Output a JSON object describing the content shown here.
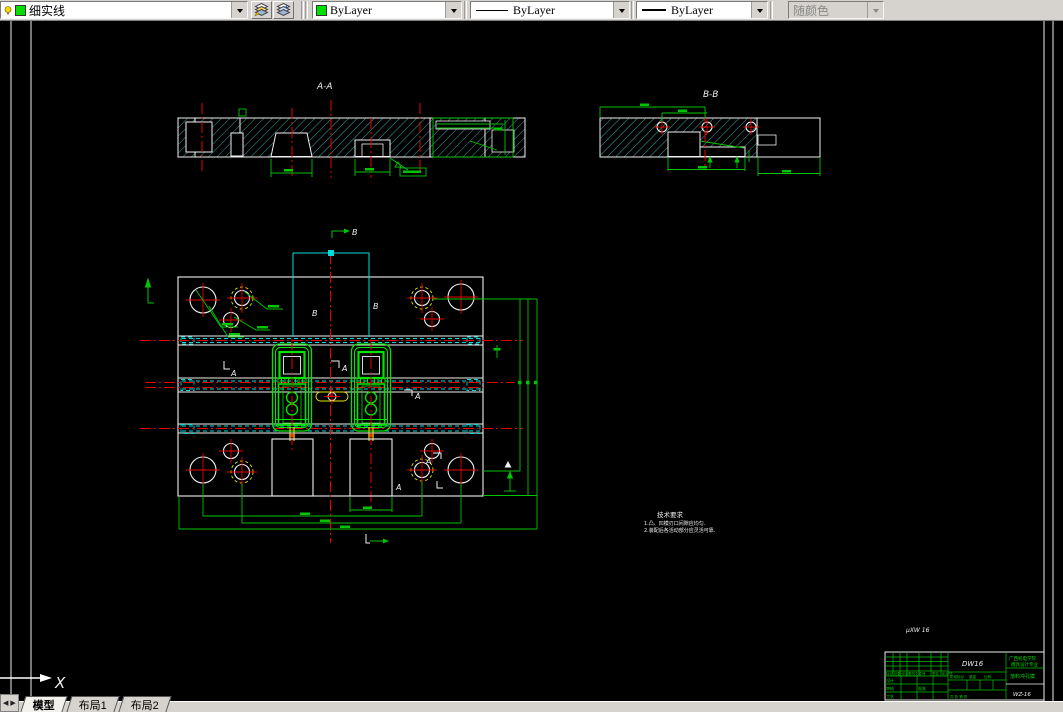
{
  "toolbar": {
    "layer": {
      "name": "细实线",
      "swatch_color": "#00df00"
    },
    "color": {
      "value": "ByLayer",
      "swatch_color": "#00df00"
    },
    "linetype": {
      "value": "ByLayer"
    },
    "lineweight": {
      "value": "ByLayer"
    },
    "plot_style": {
      "value": "随颜色",
      "disabled": true
    }
  },
  "drawing": {
    "section_aa_label": "A-A",
    "section_bb_label": "B-B",
    "marker_a": "A",
    "marker_b": "B",
    "ucs_x_label": "X",
    "notes": {
      "title": "技术要求",
      "line1": "1.凸、凹模刃口间隙应均匀.",
      "line2": "2.装配后各活动部分应灵活可靠."
    },
    "title_block": {
      "above_text": "μXW 16",
      "drawing_code": "DW16",
      "drawing_no": "WZ-16",
      "org_line1": "广西机电学院",
      "org_line2": "模具设计专业",
      "part_name": "落料冲孔模",
      "header_cells": [
        "标记",
        "处数",
        "分区",
        "更改文件号",
        "签名",
        "年月日"
      ],
      "row_labels": [
        "设计",
        "审核",
        "工艺",
        "批准"
      ],
      "misc_labels": [
        "阶段标记",
        "重量",
        "比例",
        "共 张 第 张"
      ]
    }
  },
  "statusbar": {
    "tabs": [
      {
        "label": "模型"
      },
      {
        "label": "布局1"
      },
      {
        "label": "布局2"
      }
    ]
  }
}
